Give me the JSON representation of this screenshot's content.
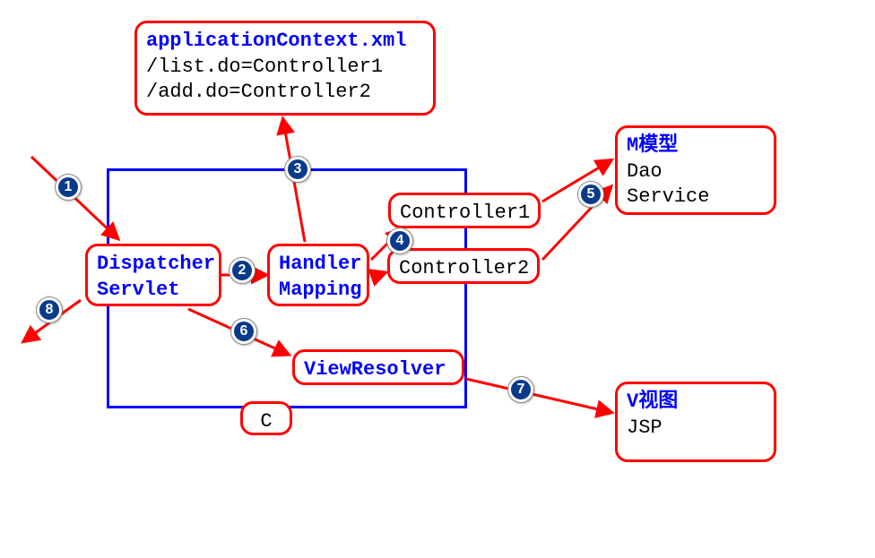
{
  "appContext": {
    "title": "applicationContext.xml",
    "line1": "/list.do=Controller1",
    "line2": "/add.do=Controller2"
  },
  "dispatcher": {
    "line1": "Dispatcher",
    "line2": "Servlet"
  },
  "handlerMapping": {
    "line1": "Handler",
    "line2": "Mapping"
  },
  "controller1": {
    "label": "Controller1"
  },
  "controller2": {
    "label": "Controller2"
  },
  "viewResolver": {
    "label": "ViewResolver"
  },
  "cBox": {
    "label": "C"
  },
  "model": {
    "title": "M模型",
    "line1": "Dao",
    "line2": "Service"
  },
  "view": {
    "title": "V视图",
    "line1": "JSP"
  },
  "steps": {
    "s1": "1",
    "s2": "2",
    "s3": "3",
    "s4": "4",
    "s5": "5",
    "s6": "6",
    "s7": "7",
    "s8": "8"
  }
}
